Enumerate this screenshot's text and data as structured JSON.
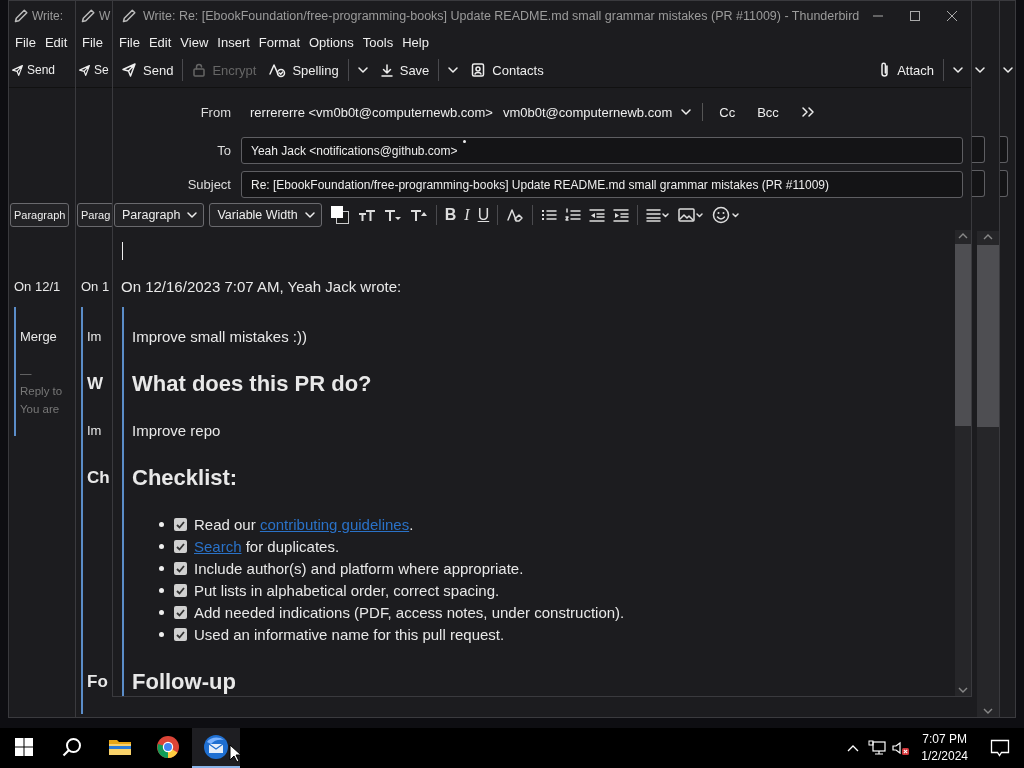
{
  "background_windows": [
    {
      "title": "Write:",
      "menu": [
        "File",
        "Edit"
      ],
      "toolbar": [
        {
          "kind": "send",
          "label": "Send",
          "disabled": false
        }
      ],
      "format_bar": [
        {
          "kind": "select",
          "label": "Paragraph"
        }
      ],
      "attribution": "On 12/1",
      "quote": [
        {
          "kind": "p",
          "text": "Merge"
        },
        {
          "kind": "sig",
          "text": "—"
        },
        {
          "kind": "sig",
          "text": "Reply to"
        },
        {
          "kind": "sig",
          "text": "You are"
        }
      ],
      "scrollbar_visible": false
    },
    {
      "title": "W",
      "menu": [
        "File"
      ],
      "toolbar": [
        {
          "kind": "send",
          "label": "Se",
          "disabled": false
        }
      ],
      "format_bar": [
        {
          "kind": "select",
          "label": "Parag"
        }
      ],
      "attribution": "On 1",
      "quote": [
        {
          "kind": "p",
          "text": "Im"
        },
        {
          "kind": "h2",
          "text": "W"
        },
        {
          "kind": "p",
          "text": "Im"
        },
        {
          "kind": "h2",
          "text": "Ch"
        },
        {
          "kind": "tail_heading",
          "text": "Fo"
        }
      ],
      "scrollbar_visible": true
    }
  ],
  "window": {
    "title": "Write: Re: [EbookFoundation/free-programming-books] Update README.md small grammar mistakes (PR #11009) - Thunderbird",
    "menu": [
      "File",
      "Edit",
      "View",
      "Insert",
      "Format",
      "Options",
      "Tools",
      "Help"
    ],
    "toolbar": [
      {
        "kind": "send",
        "label": "Send",
        "disabled": false
      },
      {
        "kind": "sep"
      },
      {
        "kind": "encrypt",
        "label": "Encrypt",
        "disabled": true
      },
      {
        "kind": "spelling",
        "label": "Spelling",
        "disabled": false
      },
      {
        "kind": "sep"
      },
      {
        "kind": "chevron"
      },
      {
        "kind": "save",
        "label": "Save",
        "disabled": false
      },
      {
        "kind": "sep"
      },
      {
        "kind": "chevron"
      },
      {
        "kind": "contacts",
        "label": "Contacts",
        "disabled": false
      },
      {
        "kind": "spacer"
      },
      {
        "kind": "attach",
        "label": "Attach",
        "disabled": false
      },
      {
        "kind": "sep"
      },
      {
        "kind": "chevron"
      }
    ],
    "from": {
      "label": "From",
      "value": "rerrererre <vm0b0t@computernewb.com>",
      "identity": "vm0b0t@computernewb.com"
    },
    "header_buttons": [
      "Cc",
      "Bcc"
    ],
    "to": {
      "label": "To",
      "recipients": [
        "Yeah Jack <notifications@github.com>"
      ]
    },
    "subject": {
      "label": "Subject",
      "value": "Re: [EbookFoundation/free-programming-books] Update README.md small grammar mistakes (PR #11009)"
    },
    "format_bar": [
      {
        "kind": "select",
        "label": "Paragraph"
      },
      {
        "kind": "select",
        "label": "Variable Width"
      },
      {
        "kind": "color"
      },
      {
        "kind": "reset_size"
      },
      {
        "kind": "smaller"
      },
      {
        "kind": "larger"
      },
      {
        "kind": "sep"
      },
      {
        "kind": "bold",
        "label": "B"
      },
      {
        "kind": "italic",
        "label": "I"
      },
      {
        "kind": "underline",
        "label": "U"
      },
      {
        "kind": "sep"
      },
      {
        "kind": "remove_format"
      },
      {
        "kind": "sep"
      },
      {
        "kind": "bullets"
      },
      {
        "kind": "numbers"
      },
      {
        "kind": "outdent"
      },
      {
        "kind": "indent"
      },
      {
        "kind": "sep"
      },
      {
        "kind": "align"
      },
      {
        "kind": "image"
      },
      {
        "kind": "emoji"
      }
    ],
    "body": {
      "attribution": "On 12/16/2023 7:07 AM, Yeah Jack wrote:",
      "quote": [
        {
          "kind": "p",
          "text": "Improve small mistakes :))"
        },
        {
          "kind": "h2",
          "text": "What does this PR do?"
        },
        {
          "kind": "p",
          "text": "Improve repo"
        },
        {
          "kind": "h2",
          "text": "Checklist:"
        },
        {
          "kind": "checklist",
          "items": [
            {
              "checked": true,
              "parts": [
                {
                  "kind": "text",
                  "text": "Read our "
                },
                {
                  "kind": "link",
                  "text": "contributing guidelines"
                },
                {
                  "kind": "text",
                  "text": "."
                }
              ]
            },
            {
              "checked": true,
              "parts": [
                {
                  "kind": "link",
                  "text": "Search"
                },
                {
                  "kind": "text",
                  "text": " for duplicates."
                }
              ]
            },
            {
              "checked": true,
              "parts": [
                {
                  "kind": "text",
                  "text": "Include author(s) and platform where appropriate."
                }
              ]
            },
            {
              "checked": true,
              "parts": [
                {
                  "kind": "text",
                  "text": "Put lists in alphabetical order, correct spacing."
                }
              ]
            },
            {
              "checked": true,
              "parts": [
                {
                  "kind": "text",
                  "text": "Add needed indications (PDF, access notes, under construction)."
                }
              ]
            },
            {
              "checked": true,
              "parts": [
                {
                  "kind": "text",
                  "text": "Used an informative name for this pull request."
                }
              ]
            }
          ]
        },
        {
          "kind": "h2",
          "text": "Follow-up"
        }
      ]
    }
  },
  "taskbar": {
    "apps": [
      {
        "kind": "start",
        "selected": false
      },
      {
        "kind": "search",
        "selected": false
      },
      {
        "kind": "folder",
        "selected": false
      },
      {
        "kind": "browser",
        "selected": false
      },
      {
        "kind": "mail",
        "selected": true
      }
    ],
    "tray": [
      {
        "kind": "chevron_up"
      },
      {
        "kind": "network"
      },
      {
        "kind": "volume_muted"
      }
    ],
    "time": "7:07 PM",
    "date": "1/2/2024"
  }
}
